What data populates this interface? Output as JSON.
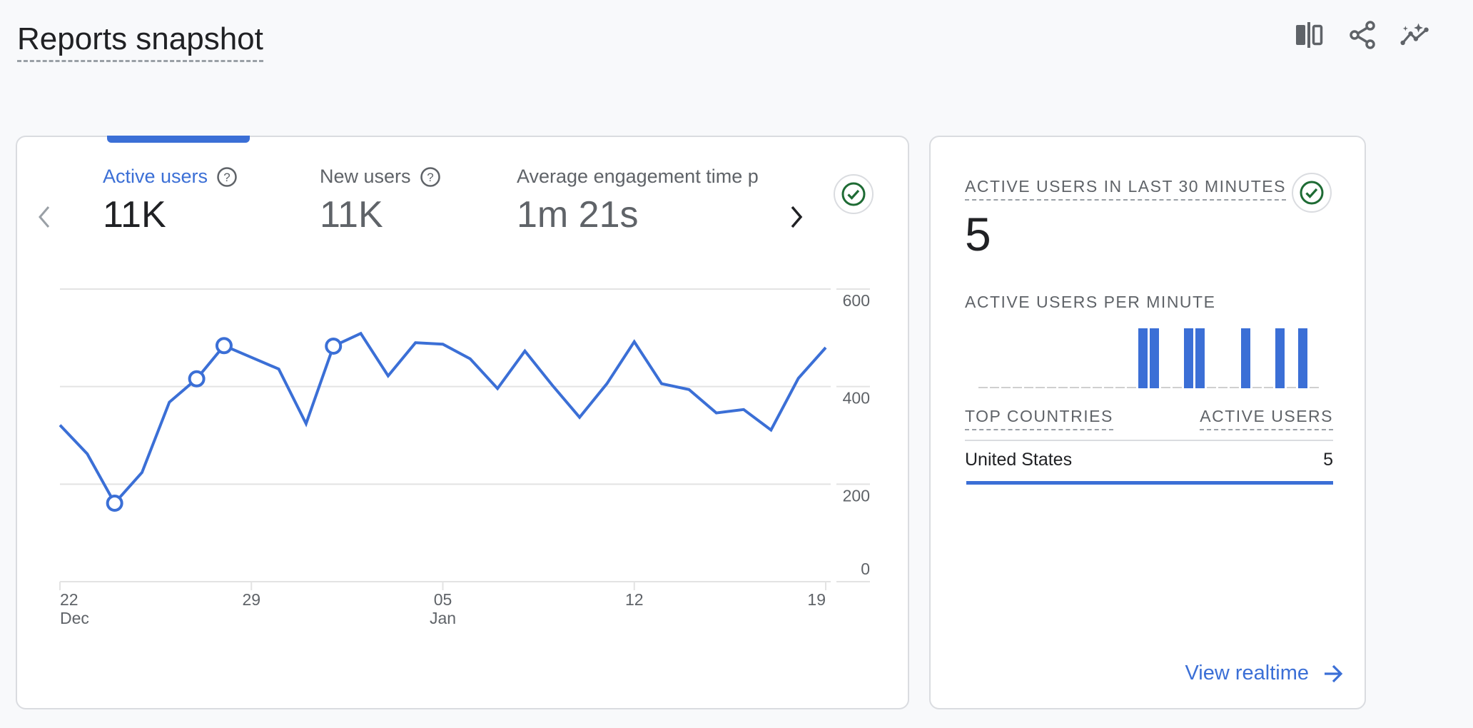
{
  "page": {
    "title": "Reports snapshot",
    "toolbar": [
      {
        "icon": "compare-icon",
        "label": "Compare"
      },
      {
        "icon": "share-icon",
        "label": "Share"
      },
      {
        "icon": "insights-icon",
        "label": "Insights"
      }
    ]
  },
  "main_card": {
    "metrics": [
      {
        "label": "Active users",
        "value": "11K",
        "has_help": true,
        "active": true
      },
      {
        "label": "New users",
        "value": "11K",
        "has_help": true,
        "active": false
      },
      {
        "label": "Average engagement time p",
        "value": "1m 21s",
        "has_help": false,
        "active": false
      }
    ],
    "status_icon": "check-circle-icon"
  },
  "chart_data": {
    "type": "line",
    "title": "",
    "xlabel": "",
    "ylabel": "",
    "ylim": [
      0,
      600
    ],
    "y_ticks": [
      "0",
      "200",
      "400",
      "600"
    ],
    "y_tick_values": [
      0,
      200,
      400,
      600
    ],
    "x_ticks": [
      {
        "index": 0,
        "day": "22",
        "month": "Dec"
      },
      {
        "index": 7,
        "day": "29",
        "month": ""
      },
      {
        "index": 14,
        "day": "05",
        "month": "Jan"
      },
      {
        "index": 21,
        "day": "12",
        "month": ""
      },
      {
        "index": 28,
        "day": "19",
        "month": ""
      }
    ],
    "grid": true,
    "color": "#3b6fd6",
    "series": [
      {
        "name": "Active users",
        "x": [
          "Dec 22",
          "Dec 23",
          "Dec 24",
          "Dec 25",
          "Dec 26",
          "Dec 27",
          "Dec 28",
          "Dec 29",
          "Dec 30",
          "Dec 31",
          "Jan 01",
          "Jan 02",
          "Jan 03",
          "Jan 04",
          "Jan 05",
          "Jan 06",
          "Jan 07",
          "Jan 08",
          "Jan 09",
          "Jan 10",
          "Jan 11",
          "Jan 12",
          "Jan 13",
          "Jan 14",
          "Jan 15",
          "Jan 16",
          "Jan 17",
          "Jan 18",
          "Jan 19"
        ],
        "values": [
          321,
          262,
          161,
          224,
          368,
          416,
          484,
          460,
          436,
          324,
          483,
          509,
          422,
          490,
          487,
          457,
          396,
          473,
          403,
          337,
          406,
          492,
          406,
          394,
          346,
          353,
          311,
          417,
          480
        ],
        "markers": [
          2,
          5,
          6,
          10
        ]
      }
    ]
  },
  "realtime_card": {
    "title": "ACTIVE USERS IN LAST 30 MINUTES",
    "value": "5",
    "per_minute_label": "ACTIVE USERS PER MINUTE",
    "per_minute": [
      0,
      0,
      0,
      0,
      0,
      0,
      0,
      0,
      0,
      0,
      0,
      0,
      0,
      0,
      1,
      1,
      0,
      0,
      1,
      1,
      0,
      0,
      0,
      1,
      0,
      0,
      1,
      0,
      1,
      0
    ],
    "table": {
      "col1": "TOP COUNTRIES",
      "col2": "ACTIVE USERS",
      "rows": [
        {
          "country": "United States",
          "users": "5",
          "share": 1.0
        }
      ]
    },
    "link": "View realtime"
  },
  "colors": {
    "accent": "#3b6fd6",
    "success": "#1e6b34",
    "muted": "#5f6368"
  }
}
